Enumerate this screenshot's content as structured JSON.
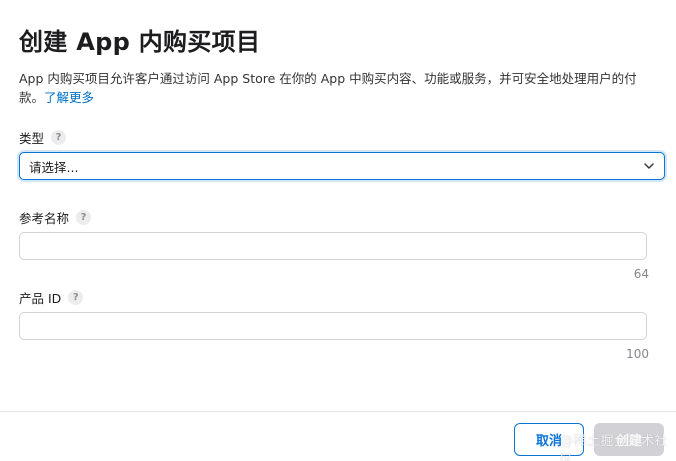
{
  "dialog": {
    "title": "创建 App 内购买项目",
    "description": "App 内购买项目允许客户通过访问 App Store 在你的 App 中购买内容、功能或服务，并可安全地处理用户的付款。",
    "learn_more": "了解更多"
  },
  "fields": {
    "type": {
      "label": "类型",
      "help": "?",
      "value": "请选择..."
    },
    "reference_name": {
      "label": "参考名称",
      "help": "?",
      "value": "",
      "counter": "64"
    },
    "product_id": {
      "label": "产品 ID",
      "help": "?",
      "value": "",
      "counter": "100"
    }
  },
  "footer": {
    "cancel_label": "取消",
    "create_label": "创建"
  },
  "watermark": "@稀土掘金技术社区",
  "icons": {
    "select_chevron": "chevron-down-icon",
    "help": "question-mark-icon"
  },
  "colors": {
    "accent": "#0a74d8",
    "link": "#0070c9",
    "disabled_button": "#d1d1d6"
  }
}
